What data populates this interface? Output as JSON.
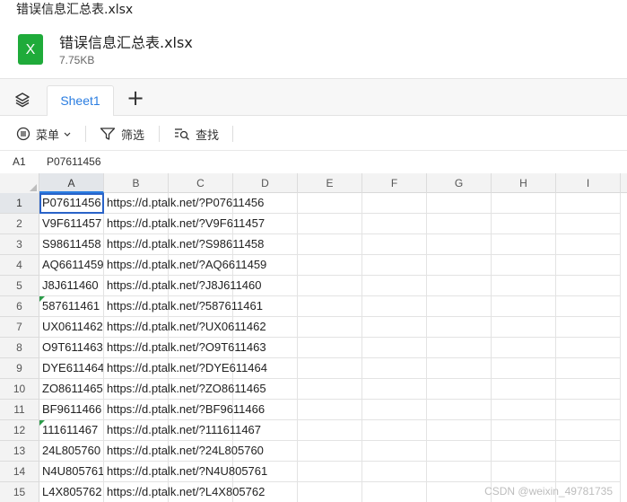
{
  "window": {
    "title": "错误信息汇总表.xlsx"
  },
  "file": {
    "name": "错误信息汇总表.xlsx",
    "size": "7.75KB",
    "icon": "excel-file-icon",
    "icon_color": "#1fab3a"
  },
  "tabs": {
    "active": "Sheet1",
    "items": [
      {
        "label": "Sheet1"
      }
    ]
  },
  "toolbar": {
    "menu_label": "菜单",
    "filter_label": "筛选",
    "find_label": "查找"
  },
  "formula_bar": {
    "cell_ref": "A1",
    "value": "P07611456"
  },
  "columns": [
    "A",
    "B",
    "C",
    "D",
    "E",
    "F",
    "G",
    "H",
    "I"
  ],
  "rows": [
    {
      "num": "1",
      "a": "P07611456",
      "b": "https://d.ptalk.net/?P07611456",
      "flag": false
    },
    {
      "num": "2",
      "a": "V9F611457",
      "b": "https://d.ptalk.net/?V9F611457",
      "flag": false
    },
    {
      "num": "3",
      "a": "S98611458",
      "b": "https://d.ptalk.net/?S98611458",
      "flag": false
    },
    {
      "num": "4",
      "a": "AQ6611459",
      "b": "https://d.ptalk.net/?AQ6611459",
      "flag": false
    },
    {
      "num": "5",
      "a": "J8J611460",
      "b": "https://d.ptalk.net/?J8J611460",
      "flag": false
    },
    {
      "num": "6",
      "a": "587611461",
      "b": "https://d.ptalk.net/?587611461",
      "flag": true
    },
    {
      "num": "7",
      "a": "UX0611462",
      "b": "https://d.ptalk.net/?UX0611462",
      "flag": false
    },
    {
      "num": "8",
      "a": "O9T611463",
      "b": "https://d.ptalk.net/?O9T611463",
      "flag": false
    },
    {
      "num": "9",
      "a": "DYE611464",
      "b": "https://d.ptalk.net/?DYE611464",
      "flag": false
    },
    {
      "num": "10",
      "a": "ZO8611465",
      "b": "https://d.ptalk.net/?ZO8611465",
      "flag": false
    },
    {
      "num": "11",
      "a": "BF9611466",
      "b": "https://d.ptalk.net/?BF9611466",
      "flag": false
    },
    {
      "num": "12",
      "a": "111611467",
      "b": "https://d.ptalk.net/?111611467",
      "flag": true
    },
    {
      "num": "13",
      "a": "24L805760",
      "b": "https://d.ptalk.net/?24L805760",
      "flag": false
    },
    {
      "num": "14",
      "a": "N4U805761",
      "b": "https://d.ptalk.net/?N4U805761",
      "flag": false
    },
    {
      "num": "15",
      "a": "L4X805762",
      "b": "https://d.ptalk.net/?L4X805762",
      "flag": false
    }
  ],
  "watermark": "CSDN @weixin_49781735",
  "colors": {
    "accent": "#2a7de1",
    "selection": "#2a63c8",
    "number_as_text_flag": "#2c9c4a"
  }
}
